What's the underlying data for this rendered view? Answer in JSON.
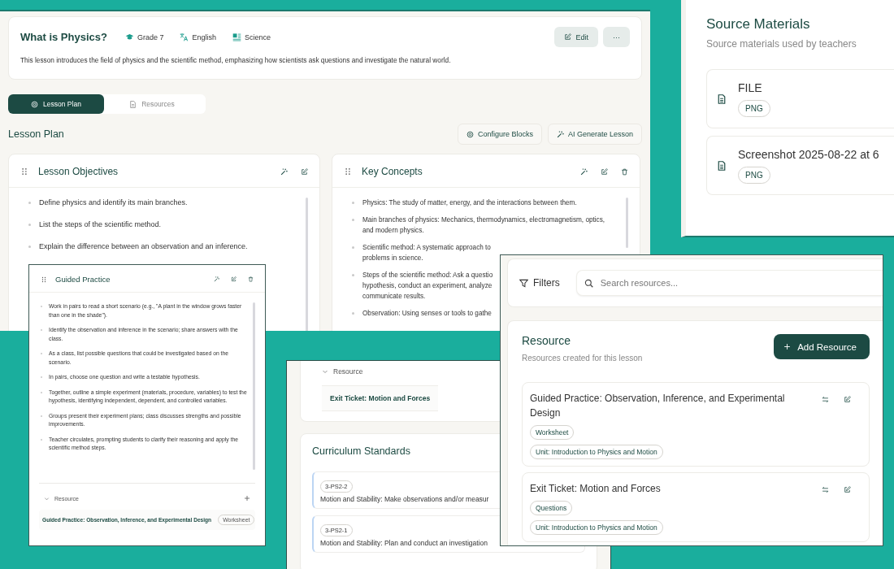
{
  "lesson_window": {
    "title": "What is Physics?",
    "meta": [
      {
        "kind": "grade",
        "label": "Grade 7"
      },
      {
        "kind": "language",
        "label": "English"
      },
      {
        "kind": "subject",
        "label": "Science"
      }
    ],
    "actions": [
      {
        "kind": "edit",
        "label": "Edit"
      },
      {
        "kind": "more",
        "label": "···"
      }
    ],
    "description": "This lesson introduces the field of physics and the scientific method, emphasizing how scientists ask questions and investigate the natural world.",
    "tabs": [
      {
        "label": "Lesson Plan",
        "selected": true
      },
      {
        "label": "Resources",
        "selected": false
      }
    ],
    "section_title": "Lesson Plan",
    "toolbar": [
      {
        "kind": "configure",
        "label": "Configure Blocks"
      },
      {
        "kind": "generate",
        "label": "AI Generate Lesson"
      }
    ],
    "blocks": [
      {
        "title": "Lesson Objectives",
        "deletable": false,
        "items": [
          "Define physics and identify its main branches.",
          "List the steps of the scientific method.",
          "Explain the difference between an observation and an inference."
        ]
      },
      {
        "title": "Key Concepts",
        "deletable": true,
        "items": [
          "Physics: The study of matter, energy, and the interactions between them.",
          "Main branches of physics: Mechanics, thermodynamics, electromagnetism, optics,\nand modern physics.",
          "Scientific method: A systematic approach to\nproblems in science.",
          "Steps of the scientific method: Ask a questio\nhypothesis, conduct an experiment, analyze\ncommunicate results.",
          "Observation: Using senses or tools to gathe"
        ]
      }
    ]
  },
  "source_materials": {
    "title": "Source Materials",
    "subtitle": "Source materials used by teachers",
    "files": [
      {
        "name": "FILE",
        "type": "PNG"
      },
      {
        "name": "Screenshot 2025-08-22 at 6",
        "type": "PNG"
      }
    ]
  },
  "lesson_details": {
    "resource_group": {
      "label": "Resource",
      "expanded": true,
      "items": [
        "Exit Ticket: Motion and Forces"
      ]
    },
    "standards": {
      "title": "Curriculum Standards",
      "items": [
        {
          "code": "3-PS2-2",
          "text": "Motion and Stability: Make observations and/or measur"
        },
        {
          "code": "3-PS2-1",
          "text": "Motion and Stability: Plan and conduct an investigation"
        }
      ]
    }
  },
  "guided_practice": {
    "title": "Guided Practice",
    "items": [
      "Work in pairs to read a short scenario (e.g., \"A plant in the window grows faster than one in the shade\").",
      "Identify the observation and inference in the scenario; share answers with the class.",
      "As a class, list possible questions that could be investigated based on the scenario.",
      "In pairs, choose one question and write a testable hypothesis.",
      "Together, outline a simple experiment (materials, procedure, variables) to test the hypothesis, identifying independent, dependent, and controlled variables.",
      "Groups present their experiment plans; class discusses strengths and possible improvements.",
      "Teacher circulates, prompting students to clarify their reasoning and apply the scientific method steps."
    ],
    "resource_group": {
      "label": "Resource",
      "expanded": true,
      "items": [
        {
          "title": "Guided Practice: Observation, Inference, and Experimental Design",
          "type": "Worksheet"
        }
      ]
    }
  },
  "resources_panel": {
    "filters_label": "Filters",
    "search": {
      "placeholder": "Search resources..."
    },
    "title": "Resource",
    "subtitle": "Resources created for this lesson",
    "add_button": "Add Resource",
    "items": [
      {
        "title": "Guided Practice: Observation, Inference, and Experimental Design",
        "type": "Worksheet",
        "unit": "Unit: Introduction to Physics and Motion"
      },
      {
        "title": "Exit Ticket: Motion and Forces",
        "type": "Questions",
        "unit": "Unit: Introduction to Physics and Motion"
      }
    ]
  }
}
